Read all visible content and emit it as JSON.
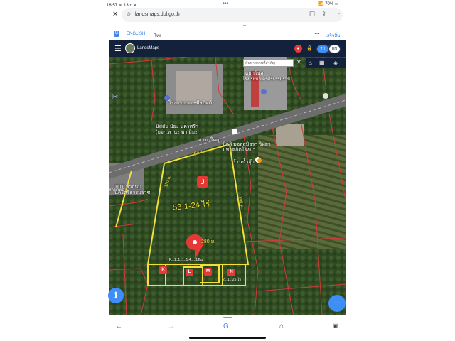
{
  "status_bar": {
    "time": "18:57",
    "date": "พ. 13 ก.ค.",
    "dots": "•••",
    "battery": "70%"
  },
  "browser": {
    "url": "landsmaps.dol.go.th",
    "close_icon": "close-icon",
    "bookmark_icon": "bookmark-icon",
    "share_icon": "share-icon",
    "menu_icon": "more-vert-icon"
  },
  "translate_bar": {
    "english": "ENGLISH",
    "thai": "ไทย",
    "done": "เสร็จสิ้น"
  },
  "app": {
    "name": "LandsMaps",
    "lang_th": "TH",
    "lang_en": "EN",
    "search_placeholder": "ค้นหาสถานที่สำคัญ"
  },
  "map_labels": {
    "hotel": "โรงแรมเดอะพีลบิตด์",
    "shop": "นิสสัน มิยะ นครศรีฯ (บจก.ลานะ พา มิยะ",
    "branch": "สาขาใหญ่",
    "junction": "แยกโนส",
    "school": "โรงเรียน นครศรีธรรมราช",
    "bank": "นิลลิ มอลสมิฮรา วิทยามหาดภิดโรงนา",
    "cafe": "ร้านน้ำจุ๊บ",
    "tot": "TOT หัวถนน นครศรีธรรมราช",
    "left_label": "สาขาตอ",
    "measure_top": "204 ม.",
    "measure_left": "150 ม.",
    "measure_right": "300 ม.",
    "measure_bottom": "280 ม.",
    "area": "53-1-24 ไร่",
    "bottom_caption": "P...1..1..1..1.4.....1ดิน",
    "lot_caption": "2...1...25 ไร่"
  },
  "plots": {
    "main": "J",
    "k": "K",
    "l": "L",
    "m": "M",
    "n": "N"
  },
  "colors": {
    "boundary": "#f2e03a",
    "marker": "#e53935",
    "header": "#14213a",
    "accent": "#3e8ef7"
  }
}
